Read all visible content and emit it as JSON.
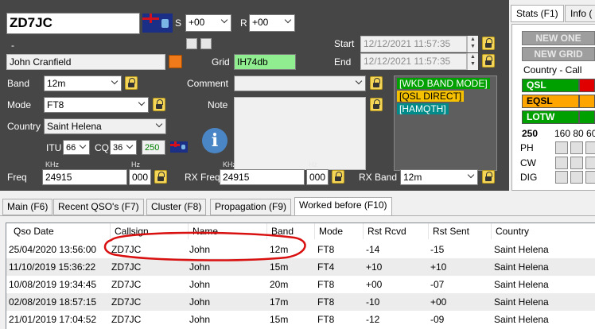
{
  "entry": {
    "callsign": "ZD7JC",
    "s_label": "S",
    "s_value": "+00",
    "r_label": "R",
    "r_value": "+00",
    "dash": "-",
    "start_label": "Start",
    "start_value": "12/12/2021 11:57:35",
    "end_label": "End",
    "end_value": "12/12/2021 11:57:35",
    "name_value": "John Cranfield",
    "grid_label": "Grid",
    "grid_value": "IH74db",
    "band_label": "Band",
    "band_value": "12m",
    "comment_label": "Comment",
    "comment_value": "",
    "mode_label": "Mode",
    "mode_value": "FT8",
    "note_label": "Note",
    "country_label": "Country",
    "country_value": "Saint Helena",
    "itu_label": "ITU",
    "itu_value": "66",
    "cq_label": "CQ",
    "cq_value": "36",
    "dxcc_value": "250",
    "freq_label": "Freq",
    "khz_label": "KHz",
    "hz_label": "Hz",
    "freq_khz": "24915",
    "freq_hz": "000",
    "rxfreq_label": "RX Freq",
    "rxfreq_khz": "24915",
    "rxfreq_hz": "000",
    "rxband_label": "RX Band",
    "rxband_value": "12m",
    "tags": [
      {
        "text": "[WKD BAND MODE]",
        "color": "#00a000"
      },
      {
        "text": "[QSL DIRECT]",
        "color": "#f5c000"
      },
      {
        "text": "[HAMQTH]",
        "color": "#008b8b"
      }
    ]
  },
  "right": {
    "tab_stats": "Stats (F1)",
    "tab_info": "Info (",
    "new_one": "NEW ONE",
    "new_grid": "NEW GRID",
    "country_call": "Country - Call",
    "qsl": "QSL",
    "eqsl": "EQSL",
    "lotw": "LOTW",
    "qsl_color": "#00a000",
    "eqsl_color": "#ffa500",
    "lotw_color": "#00a000",
    "dxcc": "250",
    "bands_header": "160 80 60",
    "modes": [
      "PH",
      "CW",
      "DIG"
    ]
  },
  "tabs": [
    "Main (F6)",
    "Recent QSO's (F7)",
    "Cluster (F8)",
    "Propagation (F9)",
    "Worked before (F10)"
  ],
  "table": {
    "headers": [
      "Qso Date",
      "Callsign",
      "Name",
      "Band",
      "Mode",
      "Rst Rcvd",
      "Rst Sent",
      "Country"
    ],
    "rows": [
      [
        "25/04/2020 13:56:00",
        "ZD7JC",
        "John",
        "12m",
        "FT8",
        "-14",
        "-15",
        "Saint Helena"
      ],
      [
        "11/10/2019 15:36:22",
        "ZD7JC",
        "John",
        "15m",
        "FT4",
        "+10",
        "+10",
        "Saint Helena"
      ],
      [
        "10/08/2019 19:34:45",
        "ZD7JC",
        "John",
        "20m",
        "FT8",
        "+00",
        "-07",
        "Saint Helena"
      ],
      [
        "02/08/2019 18:57:15",
        "ZD7JC",
        "John",
        "17m",
        "FT8",
        "-10",
        "+00",
        "Saint Helena"
      ],
      [
        "21/01/2019 17:04:52",
        "ZD7JC",
        "John",
        "15m",
        "FT8",
        "-12",
        "-09",
        "Saint Helena"
      ]
    ]
  }
}
